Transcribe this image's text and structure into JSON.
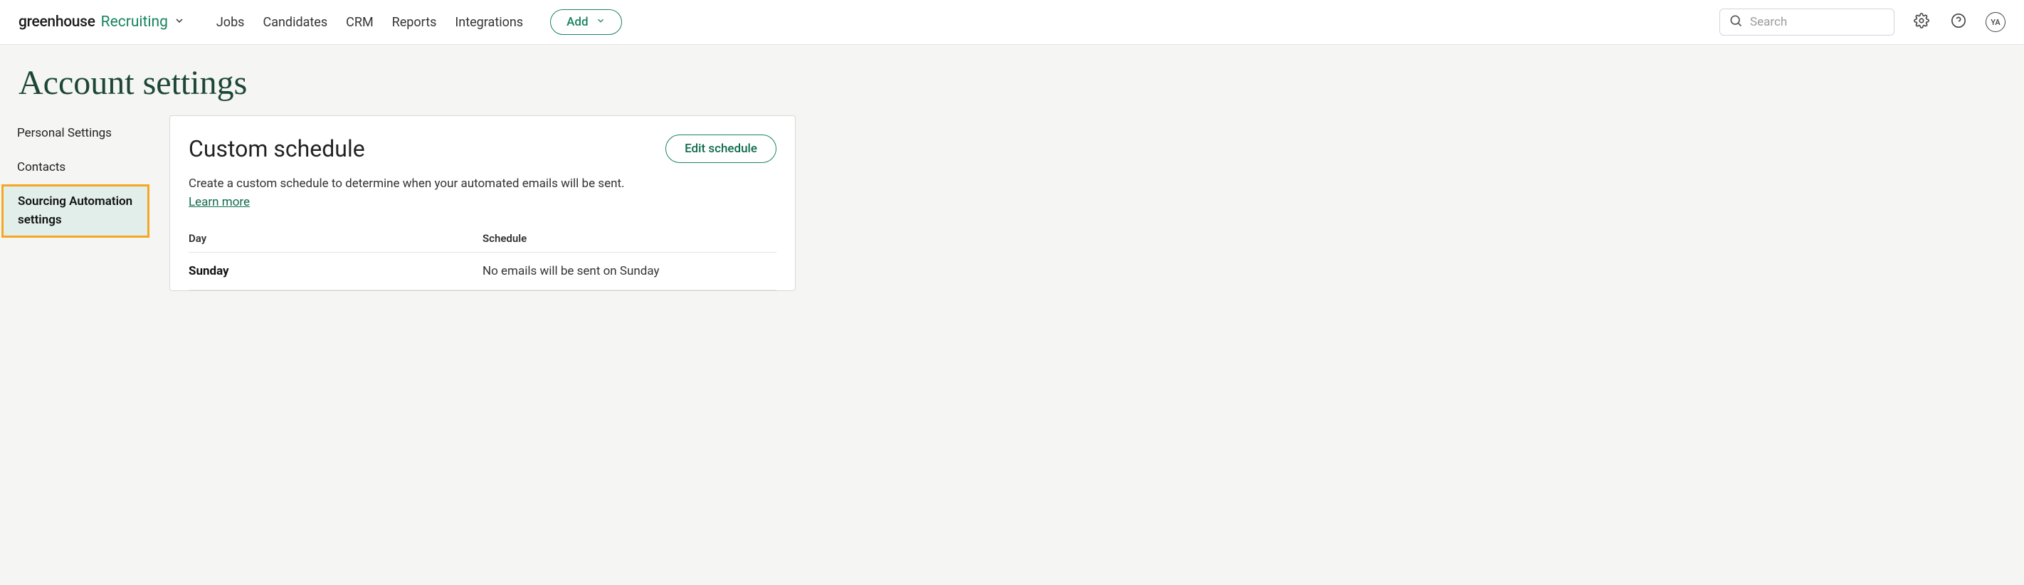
{
  "header": {
    "logo1": "greenhouse",
    "logo2": "Recruiting",
    "nav": [
      "Jobs",
      "Candidates",
      "CRM",
      "Reports",
      "Integrations"
    ],
    "add_label": "Add",
    "search_placeholder": "Search",
    "avatar_initials": "YA"
  },
  "page": {
    "title": "Account settings"
  },
  "sidebar": {
    "items": [
      {
        "label": "Personal Settings",
        "active": false
      },
      {
        "label": "Contacts",
        "active": false
      },
      {
        "label": "Sourcing Automation settings",
        "active": true
      }
    ]
  },
  "panel": {
    "title": "Custom schedule",
    "edit_label": "Edit schedule",
    "description": "Create a custom schedule to determine when your automated emails will be sent.",
    "learn_more": "Learn more",
    "columns": {
      "day": "Day",
      "schedule": "Schedule"
    },
    "rows": [
      {
        "day": "Sunday",
        "schedule": "No emails will be sent on Sunday"
      }
    ]
  }
}
